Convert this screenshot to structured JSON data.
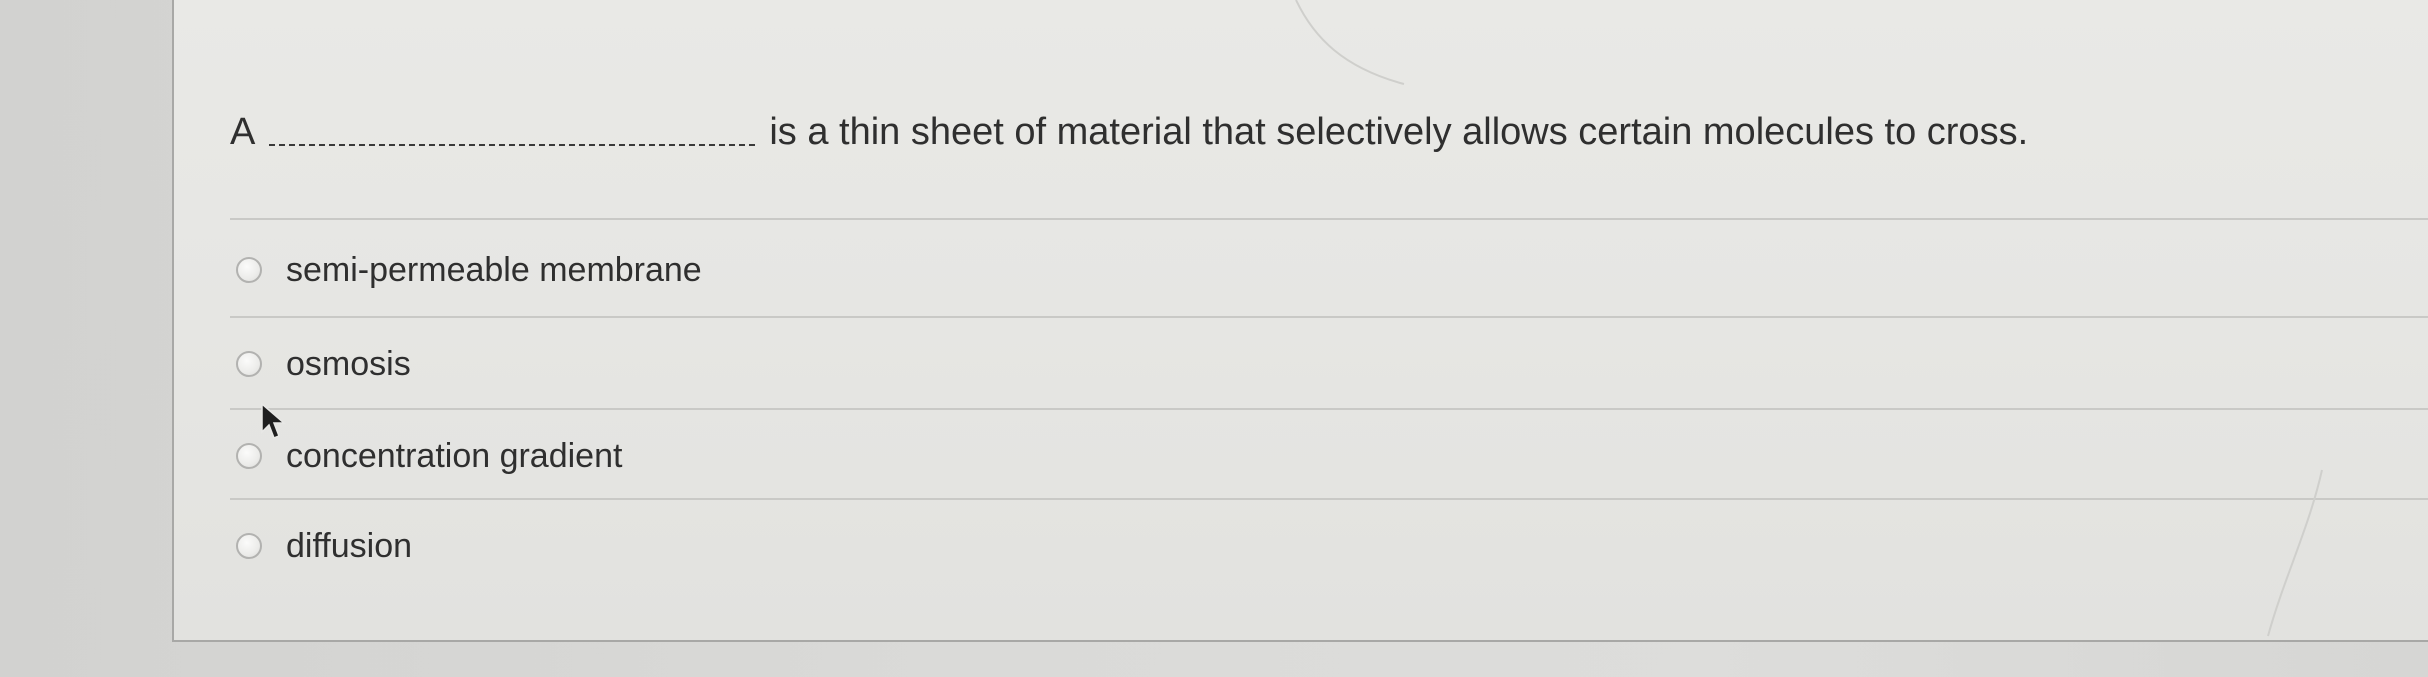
{
  "question": {
    "prompt_before": "A",
    "prompt_after": "is a thin sheet of material that selectively allows certain molecules to cross."
  },
  "options": [
    {
      "label": "semi-permeable membrane",
      "selected": false
    },
    {
      "label": "osmosis",
      "selected": false
    },
    {
      "label": "concentration gradient",
      "selected": false
    },
    {
      "label": "diffusion",
      "selected": false
    }
  ],
  "icons": {
    "radio": "radio-circle-icon",
    "cursor": "mouse-pointer-icon"
  },
  "colors": {
    "card_background": "#e7e7e4",
    "page_background": "#d8d8d6",
    "text": "#2f2f2f",
    "divider": "#c9c9c6"
  }
}
